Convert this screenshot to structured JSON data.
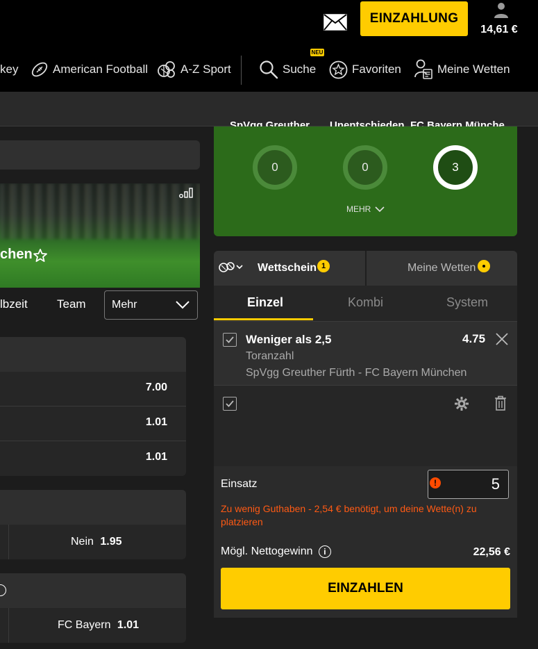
{
  "header": {
    "deposit_label": "EINZAHLUNG",
    "balance": "14,61 €"
  },
  "nav": {
    "items": [
      {
        "label": "key",
        "icon": "ice-hockey-icon"
      },
      {
        "label": "American Football",
        "icon": "american-football-icon"
      },
      {
        "label": "A-Z Sport",
        "icon": "sports-balls-icon"
      },
      {
        "label": "Suche",
        "icon": "search-icon"
      },
      {
        "label": "Favoriten",
        "icon": "star-icon"
      },
      {
        "label": "Meine Wetten",
        "icon": "my-bets-icon"
      }
    ],
    "new_badge": "NEU"
  },
  "event": {
    "title_fragment": "chen",
    "tabs": [
      "lbzeit",
      "Team"
    ],
    "more_select": "Mehr"
  },
  "markets": {
    "odds": [
      "7.00",
      "1.01",
      "1.01"
    ],
    "yes_no": {
      "label": "Nein",
      "odd": "1.95"
    },
    "team": {
      "label": "FC Bayern",
      "odd": "1.01"
    }
  },
  "prediction": {
    "labels": [
      "SpVgg Greuther ...",
      "Unentschieden",
      "FC Bayern Münche..."
    ],
    "values": [
      "0",
      "0",
      "3"
    ],
    "more_label": "MEHR"
  },
  "betslip": {
    "tab_slip": "Wettschein",
    "slip_count": "1",
    "tab_mybets": "Meine Wetten",
    "modes": [
      "Einzel",
      "Kombi",
      "System"
    ],
    "bet": {
      "selection": "Weniger als 2,5",
      "market": "Toranzahl",
      "event": "SpVgg Greuther Fürth - FC Bayern München",
      "odd": "4.75"
    },
    "stake_label": "Einsatz",
    "stake_value": "5",
    "error": "Zu wenig Guthaben - 2,54 € benötigt, um deine Wette(n) zu platzieren",
    "net_win_label": "Mögl. Nettogewinn",
    "net_win_value": "22,56 €",
    "cta": "EINZAHLEN"
  },
  "colors": {
    "accent": "#ffcc00",
    "pitch_green": "#2c6b1a",
    "error": "#ff5a14"
  }
}
